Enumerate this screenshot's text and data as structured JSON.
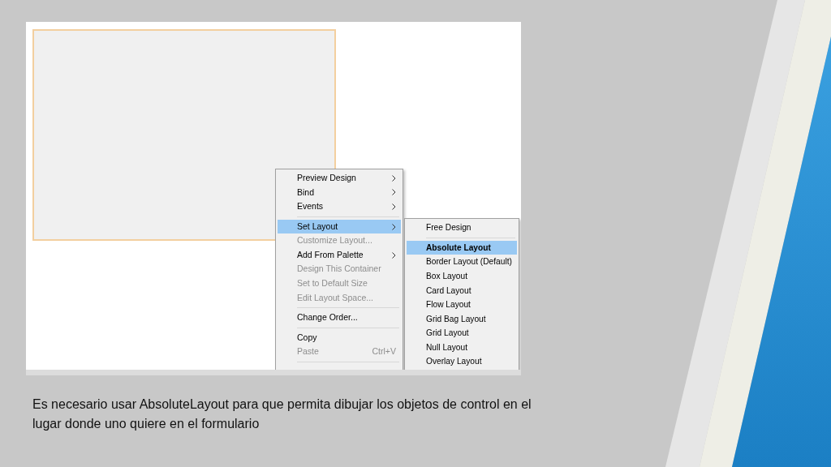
{
  "context_menu": {
    "items": [
      {
        "kind": "item",
        "label": "Preview Design",
        "submenu": true,
        "disabled": false,
        "selected": false
      },
      {
        "kind": "item",
        "label": "Bind",
        "submenu": true,
        "disabled": false,
        "selected": false
      },
      {
        "kind": "item",
        "label": "Events",
        "submenu": true,
        "disabled": false,
        "selected": false
      },
      {
        "kind": "separator"
      },
      {
        "kind": "item",
        "label": "Set Layout",
        "submenu": true,
        "disabled": false,
        "selected": true
      },
      {
        "kind": "item",
        "label": "Customize Layout...",
        "submenu": false,
        "disabled": true,
        "selected": false
      },
      {
        "kind": "item",
        "label": "Add From Palette",
        "submenu": true,
        "disabled": false,
        "selected": false
      },
      {
        "kind": "item",
        "label": "Design This Container",
        "submenu": false,
        "disabled": true,
        "selected": false
      },
      {
        "kind": "item",
        "label": "Set to Default Size",
        "submenu": false,
        "disabled": true,
        "selected": false
      },
      {
        "kind": "item",
        "label": "Edit Layout Space...",
        "submenu": false,
        "disabled": true,
        "selected": false
      },
      {
        "kind": "separator"
      },
      {
        "kind": "item",
        "label": "Change Order...",
        "submenu": false,
        "disabled": false,
        "selected": false
      },
      {
        "kind": "separator"
      },
      {
        "kind": "item",
        "label": "Copy",
        "submenu": false,
        "disabled": false,
        "selected": false
      },
      {
        "kind": "item",
        "label": "Paste",
        "shortcut": "Ctrl+V",
        "submenu": false,
        "disabled": true,
        "selected": false
      },
      {
        "kind": "separator"
      }
    ]
  },
  "submenu": {
    "items": [
      {
        "kind": "item",
        "label": "Free Design",
        "selected": false,
        "bold": false
      },
      {
        "kind": "separator"
      },
      {
        "kind": "item",
        "label": "Absolute Layout",
        "selected": true,
        "bold": true
      },
      {
        "kind": "item",
        "label": "Border Layout (Default)",
        "selected": false,
        "bold": false
      },
      {
        "kind": "item",
        "label": "Box Layout",
        "selected": false,
        "bold": false
      },
      {
        "kind": "item",
        "label": "Card Layout",
        "selected": false,
        "bold": false
      },
      {
        "kind": "item",
        "label": "Flow Layout",
        "selected": false,
        "bold": false
      },
      {
        "kind": "item",
        "label": "Grid Bag Layout",
        "selected": false,
        "bold": false
      },
      {
        "kind": "item",
        "label": "Grid Layout",
        "selected": false,
        "bold": false
      },
      {
        "kind": "item",
        "label": "Null Layout",
        "selected": false,
        "bold": false
      },
      {
        "kind": "item",
        "label": "Overlay Layout",
        "selected": false,
        "bold": false
      }
    ]
  },
  "caption": "Es necesario usar AbsoluteLayout para que permita dibujar los objetos de control en el lugar donde uno quiere en el formulario"
}
